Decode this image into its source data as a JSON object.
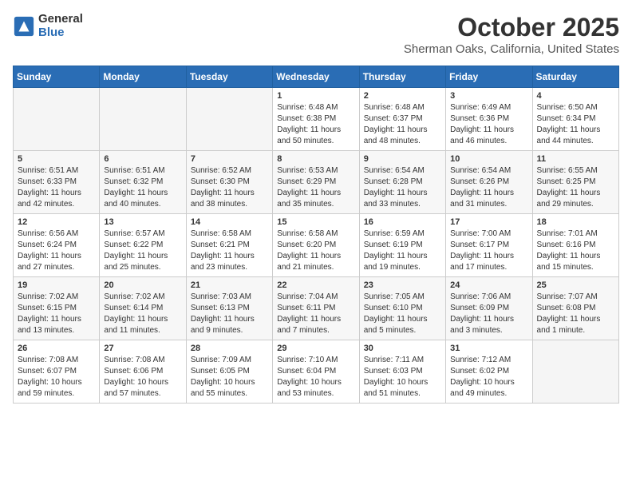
{
  "header": {
    "logo": {
      "general": "General",
      "blue": "Blue"
    },
    "title": "October 2025",
    "location": "Sherman Oaks, California, United States"
  },
  "days_of_week": [
    "Sunday",
    "Monday",
    "Tuesday",
    "Wednesday",
    "Thursday",
    "Friday",
    "Saturday"
  ],
  "weeks": [
    [
      {
        "day": "",
        "detail": ""
      },
      {
        "day": "",
        "detail": ""
      },
      {
        "day": "",
        "detail": ""
      },
      {
        "day": "1",
        "detail": "Sunrise: 6:48 AM\nSunset: 6:38 PM\nDaylight: 11 hours\nand 50 minutes."
      },
      {
        "day": "2",
        "detail": "Sunrise: 6:48 AM\nSunset: 6:37 PM\nDaylight: 11 hours\nand 48 minutes."
      },
      {
        "day": "3",
        "detail": "Sunrise: 6:49 AM\nSunset: 6:36 PM\nDaylight: 11 hours\nand 46 minutes."
      },
      {
        "day": "4",
        "detail": "Sunrise: 6:50 AM\nSunset: 6:34 PM\nDaylight: 11 hours\nand 44 minutes."
      }
    ],
    [
      {
        "day": "5",
        "detail": "Sunrise: 6:51 AM\nSunset: 6:33 PM\nDaylight: 11 hours\nand 42 minutes."
      },
      {
        "day": "6",
        "detail": "Sunrise: 6:51 AM\nSunset: 6:32 PM\nDaylight: 11 hours\nand 40 minutes."
      },
      {
        "day": "7",
        "detail": "Sunrise: 6:52 AM\nSunset: 6:30 PM\nDaylight: 11 hours\nand 38 minutes."
      },
      {
        "day": "8",
        "detail": "Sunrise: 6:53 AM\nSunset: 6:29 PM\nDaylight: 11 hours\nand 35 minutes."
      },
      {
        "day": "9",
        "detail": "Sunrise: 6:54 AM\nSunset: 6:28 PM\nDaylight: 11 hours\nand 33 minutes."
      },
      {
        "day": "10",
        "detail": "Sunrise: 6:54 AM\nSunset: 6:26 PM\nDaylight: 11 hours\nand 31 minutes."
      },
      {
        "day": "11",
        "detail": "Sunrise: 6:55 AM\nSunset: 6:25 PM\nDaylight: 11 hours\nand 29 minutes."
      }
    ],
    [
      {
        "day": "12",
        "detail": "Sunrise: 6:56 AM\nSunset: 6:24 PM\nDaylight: 11 hours\nand 27 minutes."
      },
      {
        "day": "13",
        "detail": "Sunrise: 6:57 AM\nSunset: 6:22 PM\nDaylight: 11 hours\nand 25 minutes."
      },
      {
        "day": "14",
        "detail": "Sunrise: 6:58 AM\nSunset: 6:21 PM\nDaylight: 11 hours\nand 23 minutes."
      },
      {
        "day": "15",
        "detail": "Sunrise: 6:58 AM\nSunset: 6:20 PM\nDaylight: 11 hours\nand 21 minutes."
      },
      {
        "day": "16",
        "detail": "Sunrise: 6:59 AM\nSunset: 6:19 PM\nDaylight: 11 hours\nand 19 minutes."
      },
      {
        "day": "17",
        "detail": "Sunrise: 7:00 AM\nSunset: 6:17 PM\nDaylight: 11 hours\nand 17 minutes."
      },
      {
        "day": "18",
        "detail": "Sunrise: 7:01 AM\nSunset: 6:16 PM\nDaylight: 11 hours\nand 15 minutes."
      }
    ],
    [
      {
        "day": "19",
        "detail": "Sunrise: 7:02 AM\nSunset: 6:15 PM\nDaylight: 11 hours\nand 13 minutes."
      },
      {
        "day": "20",
        "detail": "Sunrise: 7:02 AM\nSunset: 6:14 PM\nDaylight: 11 hours\nand 11 minutes."
      },
      {
        "day": "21",
        "detail": "Sunrise: 7:03 AM\nSunset: 6:13 PM\nDaylight: 11 hours\nand 9 minutes."
      },
      {
        "day": "22",
        "detail": "Sunrise: 7:04 AM\nSunset: 6:11 PM\nDaylight: 11 hours\nand 7 minutes."
      },
      {
        "day": "23",
        "detail": "Sunrise: 7:05 AM\nSunset: 6:10 PM\nDaylight: 11 hours\nand 5 minutes."
      },
      {
        "day": "24",
        "detail": "Sunrise: 7:06 AM\nSunset: 6:09 PM\nDaylight: 11 hours\nand 3 minutes."
      },
      {
        "day": "25",
        "detail": "Sunrise: 7:07 AM\nSunset: 6:08 PM\nDaylight: 11 hours\nand 1 minute."
      }
    ],
    [
      {
        "day": "26",
        "detail": "Sunrise: 7:08 AM\nSunset: 6:07 PM\nDaylight: 10 hours\nand 59 minutes."
      },
      {
        "day": "27",
        "detail": "Sunrise: 7:08 AM\nSunset: 6:06 PM\nDaylight: 10 hours\nand 57 minutes."
      },
      {
        "day": "28",
        "detail": "Sunrise: 7:09 AM\nSunset: 6:05 PM\nDaylight: 10 hours\nand 55 minutes."
      },
      {
        "day": "29",
        "detail": "Sunrise: 7:10 AM\nSunset: 6:04 PM\nDaylight: 10 hours\nand 53 minutes."
      },
      {
        "day": "30",
        "detail": "Sunrise: 7:11 AM\nSunset: 6:03 PM\nDaylight: 10 hours\nand 51 minutes."
      },
      {
        "day": "31",
        "detail": "Sunrise: 7:12 AM\nSunset: 6:02 PM\nDaylight: 10 hours\nand 49 minutes."
      },
      {
        "day": "",
        "detail": ""
      }
    ]
  ]
}
